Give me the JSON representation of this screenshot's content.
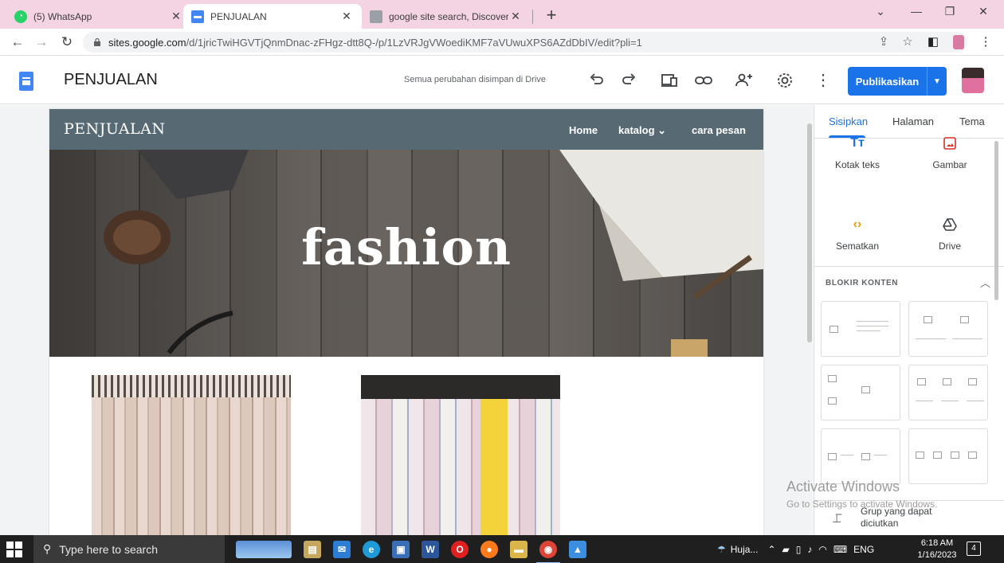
{
  "browser": {
    "tabs": [
      {
        "title": "(5) WhatsApp",
        "favicon_color": "#25d366",
        "active": false
      },
      {
        "title": "PENJUALAN",
        "favicon_color": "#4285f4",
        "active": true
      },
      {
        "title": "google site search, Discovertoda",
        "favicon_color": "#5f6368",
        "active": false
      }
    ],
    "new_tab": "+",
    "window_controls": {
      "minimize": "—",
      "restore": "❐",
      "close": "✕",
      "tabs_menu": "⌄"
    },
    "url_host": "sites.google.com",
    "url_path": "/d/1jricTwiHGVTjQnmDnac-zFHgz-dtt8Q-/p/1LzVRJgVWoediKMF7aVUwuXPS6AZdDbIV/edit?pli=1"
  },
  "sites_header": {
    "title": "PENJUALAN",
    "save_status": "Semua perubahan disimpan di Drive",
    "publish_label": "Publikasikan",
    "icons": [
      "undo-icon",
      "redo-icon",
      "preview-icon",
      "link-icon",
      "share-icon",
      "settings-icon",
      "more-vert-icon"
    ]
  },
  "site": {
    "brand": "PENJUALAN",
    "nav": {
      "home": "Home",
      "katalog": "katalog",
      "katalog_caret": "⌄",
      "cara_pesan": "cara pesan"
    },
    "hero_title": "fashion"
  },
  "panel": {
    "tabs": {
      "insert": "Sisipkan",
      "pages": "Halaman",
      "theme": "Tema"
    },
    "tools": {
      "text_box": {
        "label": "Kotak teks",
        "glyph": "Tт",
        "color": "#1a73e8"
      },
      "image": {
        "label": "Gambar",
        "color": "#d93025"
      },
      "embed": {
        "label": "Sematkan",
        "glyph": "‹›",
        "color": "#f29900"
      },
      "drive": {
        "label": "Drive",
        "color": "#3c4043"
      }
    },
    "content_blocks_label": "BLOKIR KONTEN",
    "collapsible_group": "Grup yang dapat diciutkan"
  },
  "watermark": {
    "line1": "Activate Windows",
    "line2": "Go to Settings to activate Windows."
  },
  "taskbar": {
    "search_placeholder": "Type here to search",
    "weather": "Huja...",
    "language": "ENG",
    "time": "6:18 AM",
    "date": "1/16/2023",
    "notifications": "4"
  }
}
